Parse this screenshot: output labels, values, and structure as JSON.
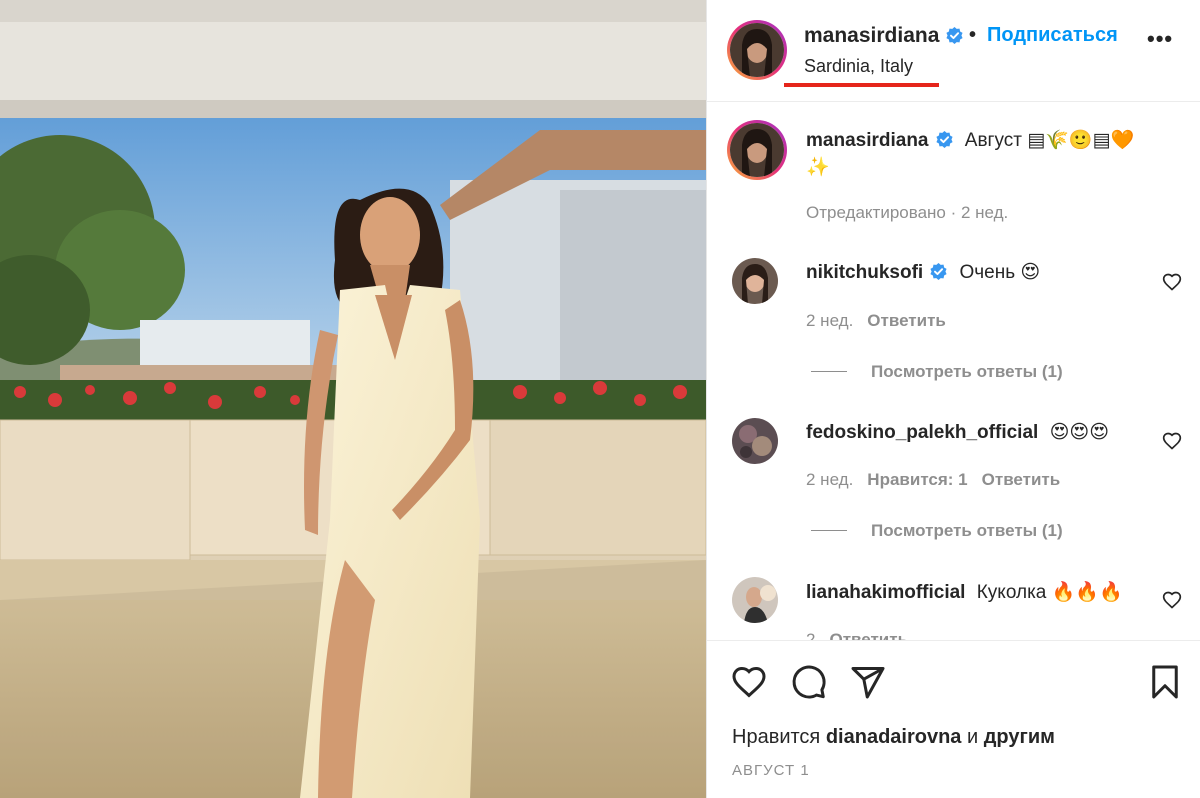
{
  "post": {
    "author": "manasirdiana",
    "follow_label": "Подписаться",
    "separator": "•",
    "location": "Sardinia, Italy",
    "more_label": "•••",
    "caption_text": "Август",
    "caption_emoji": "▤🌾🙂▤🧡",
    "caption_emoji_2": "✨",
    "caption_meta": "Отредактировано · 2 нед.",
    "verified_color": "#3897f0"
  },
  "comments": [
    {
      "user": "nikitchuksofi",
      "text": "Очень 😍",
      "time": "2 нед.",
      "likes": "",
      "reply_label": "Ответить",
      "view_replies": "Посмотреть ответы (1)"
    },
    {
      "user": "fedoskino_palekh_official",
      "text": "😍😍😍",
      "time": "2 нед.",
      "likes": "Нравится: 1",
      "reply_label": "Ответить",
      "view_replies": "Посмотреть ответы (1)"
    },
    {
      "user": "lianahakimofficial",
      "text": "Куколка 🔥🔥🔥",
      "time": "2",
      "reply_label": "Ответить"
    }
  ],
  "footer": {
    "likes_prefix": "Нравится",
    "likes_user": "dianadairovna",
    "likes_and": "и",
    "likes_others": "другим",
    "date": "АВГУСТ 1"
  },
  "icons": {
    "like": "heart-icon",
    "comment": "comment-icon",
    "share": "send-icon",
    "save": "bookmark-icon",
    "comment_like": "small-heart-icon"
  },
  "colors": {
    "accent": "#0095f6",
    "highlight_underline": "#e5251b",
    "muted": "#8e8e8e"
  }
}
